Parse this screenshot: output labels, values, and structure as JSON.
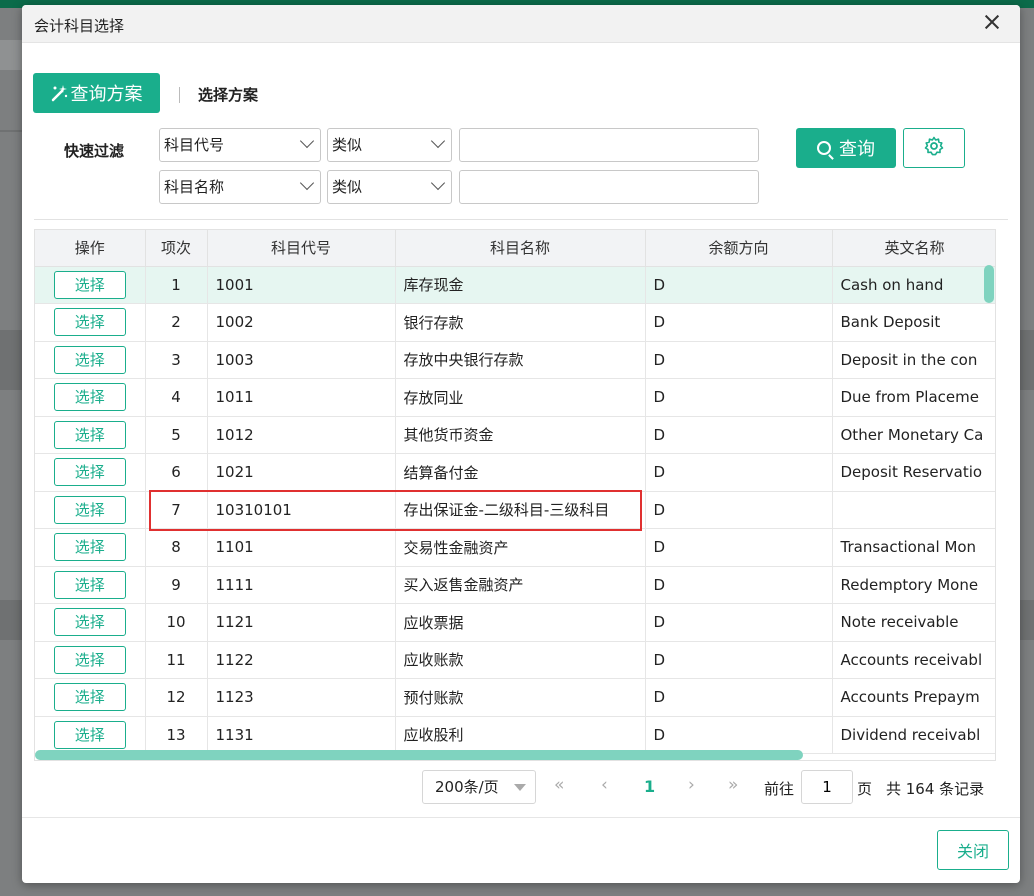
{
  "dialog": {
    "title": "会计科目选择",
    "scheme_button": "查询方案",
    "select_scheme": "选择方案",
    "filter_label": "快速过滤",
    "filters": [
      {
        "field": "科目代号",
        "op": "类似",
        "value": ""
      },
      {
        "field": "科目名称",
        "op": "类似",
        "value": ""
      }
    ],
    "query_button": "查询",
    "close_button": "关闭"
  },
  "table": {
    "columns": [
      "操作",
      "项次",
      "科目代号",
      "科目名称",
      "余额方向",
      "英文名称"
    ],
    "action_label": "选择",
    "rows": [
      {
        "no": "1",
        "code": "1001",
        "name": "库存现金",
        "dir": "D",
        "en": "Cash on hand"
      },
      {
        "no": "2",
        "code": "1002",
        "name": "银行存款",
        "dir": "D",
        "en": "Bank Deposit"
      },
      {
        "no": "3",
        "code": "1003",
        "name": "存放中央银行存款",
        "dir": "D",
        "en": "Deposit in the con"
      },
      {
        "no": "4",
        "code": "1011",
        "name": "存放同业",
        "dir": "D",
        "en": "Due from Placeme"
      },
      {
        "no": "5",
        "code": "1012",
        "name": "其他货币资金",
        "dir": "D",
        "en": "Other Monetary Ca"
      },
      {
        "no": "6",
        "code": "1021",
        "name": "结算备付金",
        "dir": "D",
        "en": "Deposit Reservatio"
      },
      {
        "no": "7",
        "code": "10310101",
        "name": "存出保证金-二级科目-三级科目",
        "dir": "D",
        "en": ""
      },
      {
        "no": "8",
        "code": "1101",
        "name": "交易性金融资产",
        "dir": "D",
        "en": "Transactional Mon"
      },
      {
        "no": "9",
        "code": "1111",
        "name": "买入返售金融资产",
        "dir": "D",
        "en": "Redemptory Mone"
      },
      {
        "no": "10",
        "code": "1121",
        "name": "应收票据",
        "dir": "D",
        "en": "Note receivable"
      },
      {
        "no": "11",
        "code": "1122",
        "name": "应收账款",
        "dir": "D",
        "en": "Accounts receivabl"
      },
      {
        "no": "12",
        "code": "1123",
        "name": "预付账款",
        "dir": "D",
        "en": "Accounts Prepaym"
      },
      {
        "no": "13",
        "code": "1131",
        "name": "应收股利",
        "dir": "D",
        "en": "Dividend receivabl"
      }
    ]
  },
  "pagination": {
    "page_size": "200条/页",
    "current_page": "1",
    "goto_prefix": "前往",
    "goto_value": "1",
    "goto_suffix": "页",
    "total": "共 164 条记录",
    "first": "«",
    "prev": "‹",
    "next": "›",
    "last": "»"
  },
  "colors": {
    "accent": "#1aae8c",
    "highlight_row": "#e6f6f1",
    "annotation_box": "#e03030"
  }
}
